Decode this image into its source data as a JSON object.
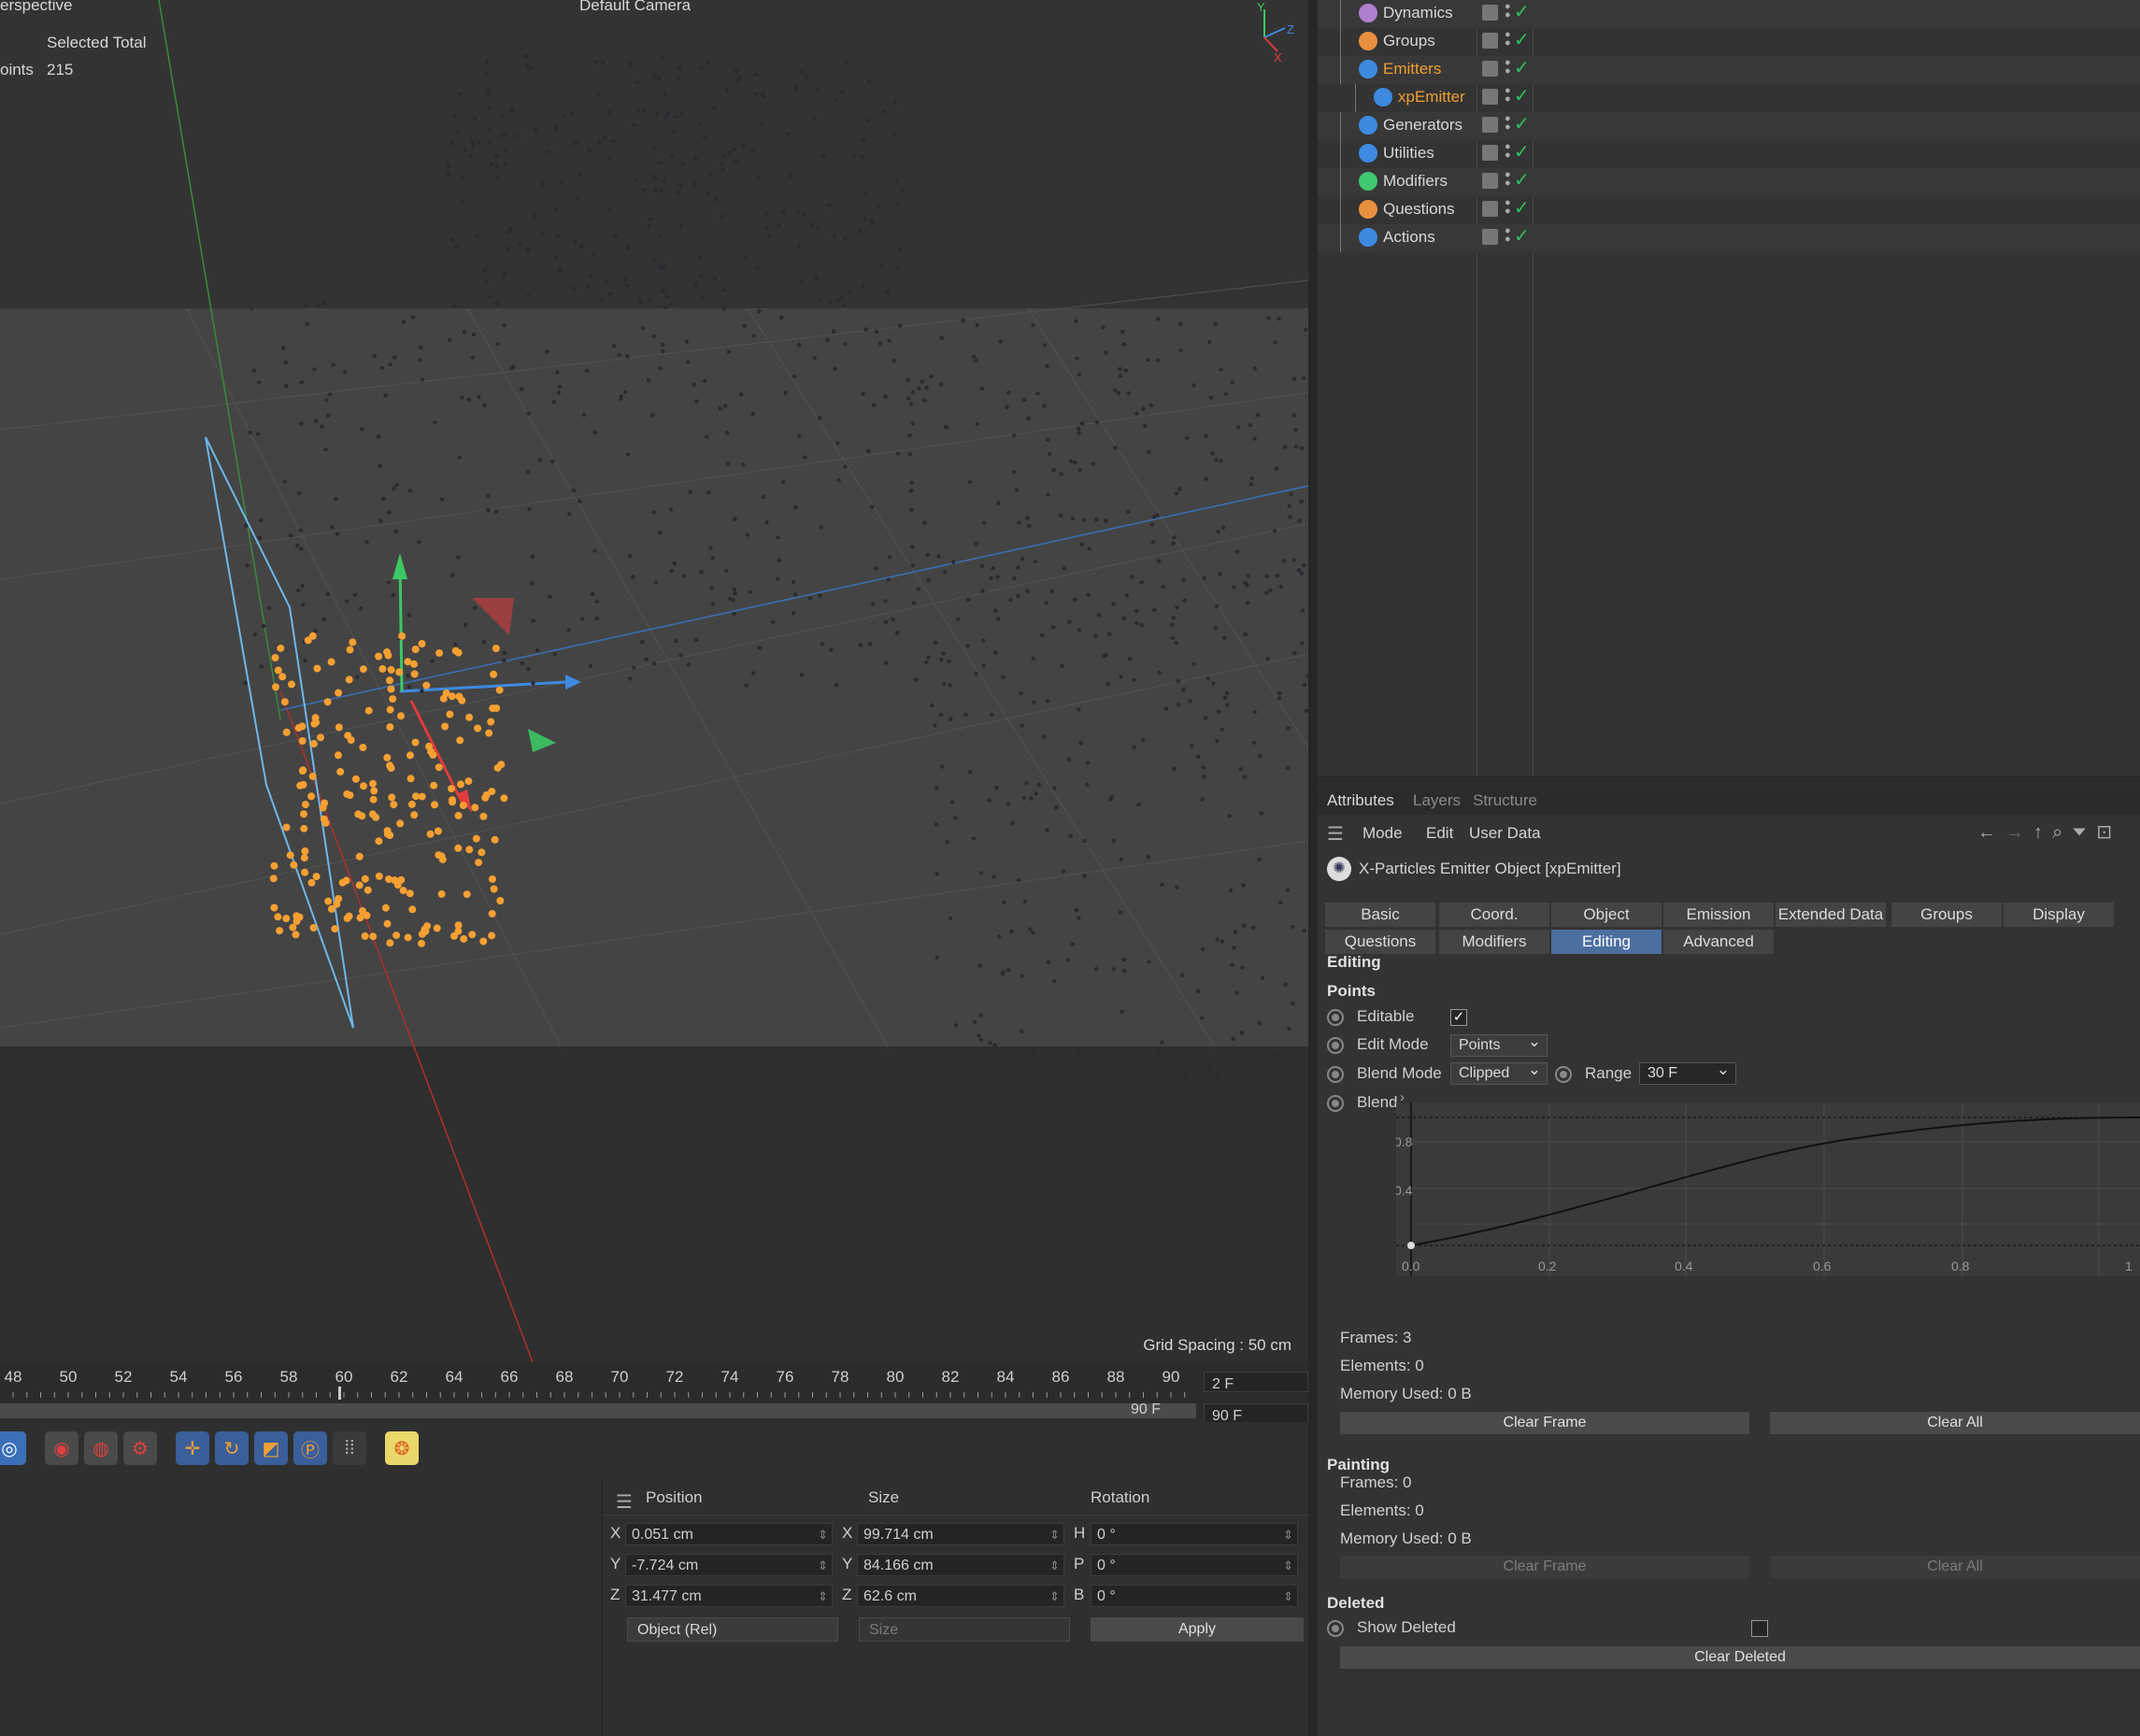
{
  "viewport": {
    "view_name": "erspective",
    "camera": "Default Camera",
    "hud": {
      "header": "Selected Total",
      "row_label": "oints",
      "row_value": "215"
    },
    "grid_spacing": "Grid Spacing : 50 cm"
  },
  "timeline": {
    "ticks": [
      "48",
      "50",
      "52",
      "54",
      "56",
      "58",
      "60",
      "62",
      "64",
      "66",
      "68",
      "70",
      "72",
      "74",
      "76",
      "78",
      "80",
      "82",
      "84",
      "86",
      "88",
      "90"
    ],
    "current_frame": "2 F",
    "end_frame": "90 F",
    "range_end": "90 F"
  },
  "object_manager": {
    "items": [
      {
        "label": "Dynamics",
        "icon": "xp-icon-purple",
        "active": false
      },
      {
        "label": "Groups",
        "icon": "xp-icon-orange",
        "active": false
      },
      {
        "label": "Emitters",
        "icon": "xp-icon-blue",
        "active": true
      },
      {
        "label": "xpEmitter",
        "icon": "emitter-icon",
        "active": true,
        "child": true
      },
      {
        "label": "Generators",
        "icon": "xp-icon-blue",
        "active": false
      },
      {
        "label": "Utilities",
        "icon": "xp-icon-blue",
        "active": false
      },
      {
        "label": "Modifiers",
        "icon": "xp-icon-green",
        "active": false
      },
      {
        "label": "Questions",
        "icon": "xp-icon-orange",
        "active": false
      },
      {
        "label": "Actions",
        "icon": "xp-icon-blue",
        "active": false
      }
    ],
    "colors": {
      "active_text": "#f0a030",
      "check": "#2fbf64"
    }
  },
  "attributes": {
    "top_tabs": [
      "Attributes",
      "Layers",
      "Structure"
    ],
    "menu": [
      "Mode",
      "Edit",
      "User Data"
    ],
    "object_title": "X-Particles Emitter Object [xpEmitter]",
    "tabs_row1": [
      "Basic",
      "Coord.",
      "Object",
      "Emission",
      "Extended Data",
      "Groups",
      "Display"
    ],
    "tabs_row2": [
      "Questions",
      "Modifiers",
      "Editing",
      "Advanced"
    ],
    "active_tab": "Editing",
    "section_editing": "Editing",
    "section_points": "Points",
    "editable_label": "Editable",
    "edit_mode_label": "Edit Mode",
    "edit_mode_value": "Points",
    "blend_mode_label": "Blend Mode",
    "blend_mode_value": "Clipped",
    "range_label": "Range",
    "range_value": "30 F",
    "blend_label": "Blend",
    "graph": {
      "y_ticks": [
        "0.8",
        "0.4"
      ],
      "x_ticks": [
        "0.0",
        "0.2",
        "0.4",
        "0.6",
        "0.8",
        "1"
      ]
    },
    "points_info": {
      "frames": "Frames: 3",
      "elements": "Elements: 0",
      "memory": "Memory Used: 0 B"
    },
    "clear_frame": "Clear Frame",
    "clear_all": "Clear All",
    "section_painting": "Painting",
    "painting_info": {
      "frames": "Frames: 0",
      "elements": "Elements: 0",
      "memory": "Memory Used: 0 B"
    },
    "section_deleted": "Deleted",
    "show_deleted_label": "Show Deleted",
    "clear_deleted": "Clear Deleted"
  },
  "coordinates": {
    "headers": [
      "Position",
      "Size",
      "Rotation"
    ],
    "rows": [
      {
        "axis": "X",
        "pos": "0.051 cm",
        "size_axis": "X",
        "size": "99.714 cm",
        "rot_axis": "H",
        "rot": "0 °"
      },
      {
        "axis": "Y",
        "pos": "-7.724 cm",
        "size_axis": "Y",
        "size": "84.166 cm",
        "rot_axis": "P",
        "rot": "0 °"
      },
      {
        "axis": "Z",
        "pos": "31.477 cm",
        "size_axis": "Z",
        "size": "62.6 cm",
        "rot_axis": "B",
        "rot": "0 °"
      }
    ],
    "mode_select": "Object (Rel)",
    "size_select": "Size",
    "apply": "Apply"
  }
}
